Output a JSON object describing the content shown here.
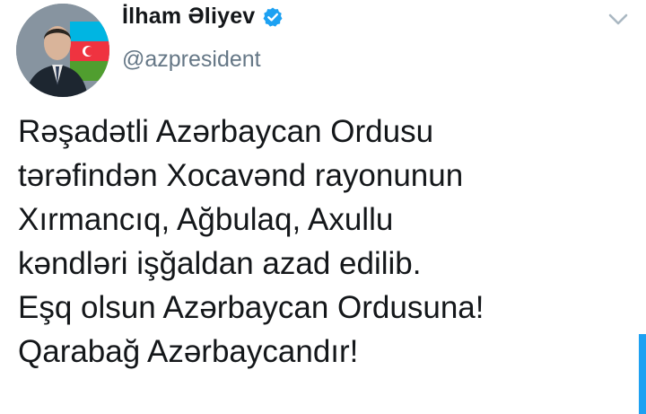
{
  "author": {
    "display_name": "İlham Əliyev",
    "handle": "@azpresident",
    "verified": true,
    "avatar_icon": "profile-photo"
  },
  "menu": {
    "icon": "chevron-down-icon"
  },
  "tweet": {
    "lines": [
      "Rəşadətli Azərbaycan Ordusu",
      "tərəfindən Xocavənd rayonunun",
      "Xırmancıq, Ağbulaq, Axullu",
      "kəndləri işğaldan azad edilib.",
      "Eşq olsun Azərbaycan Ordusuna!",
      "Qarabağ Azərbaycandır!"
    ]
  },
  "colors": {
    "text": "#14171a",
    "secondary_text": "#657786",
    "verified_blue": "#1da1f2",
    "chevron": "#aab8c2"
  }
}
